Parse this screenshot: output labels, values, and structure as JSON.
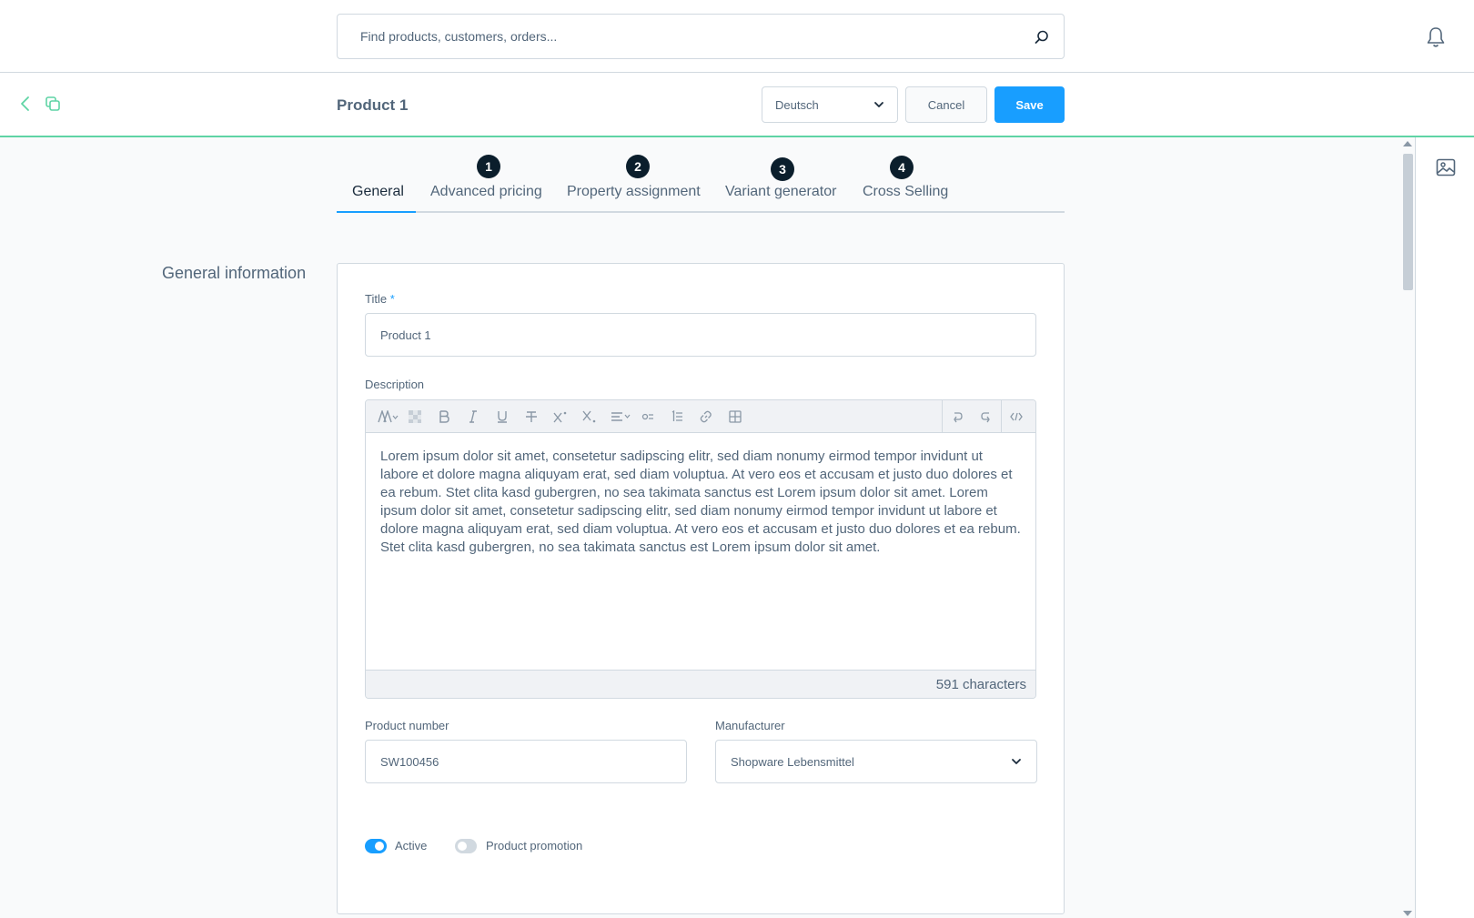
{
  "header": {
    "search_placeholder": "Find products, customers, orders...",
    "search_icon": "search-icon",
    "notification_icon": "bell-icon"
  },
  "smartbar": {
    "title": "Product 1",
    "language": "Deutsch",
    "cancel_label": "Cancel",
    "save_label": "Save",
    "back_icon": "chevron-left-icon",
    "duplicate_icon": "duplicate-icon"
  },
  "tabs": [
    {
      "label": "General",
      "badge": "",
      "active": true
    },
    {
      "label": "Advanced pricing",
      "badge": "1"
    },
    {
      "label": "Property assignment",
      "badge": "2"
    },
    {
      "label": "Variant generator",
      "badge": "3"
    },
    {
      "label": "Cross Selling",
      "badge": "4"
    }
  ],
  "section": {
    "title": "General information",
    "title_label": "Title",
    "required_mark": "*",
    "title_value": "Product 1",
    "description_label": "Description",
    "description_text": "Lorem ipsum dolor sit amet, consetetur sadipscing elitr, sed diam nonumy eirmod tempor invidunt ut labore et dolore magna aliquyam erat, sed diam voluptua. At vero eos et accusam et justo duo dolores et ea rebum. Stet clita kasd gubergren, no sea takimata sanctus est Lorem ipsum dolor sit amet. Lorem ipsum dolor sit amet, consetetur sadipscing elitr, sed diam nonumy eirmod tempor invidunt ut labore et dolore magna aliquyam erat, sed diam voluptua. At vero eos et accusam et justo duo dolores et ea rebum. Stet clita kasd gubergren, no sea takimata sanctus est Lorem ipsum dolor sit amet.",
    "char_count": "591 characters",
    "product_number_label": "Product number",
    "product_number_value": "SW100456",
    "manufacturer_label": "Manufacturer",
    "manufacturer_value": "Shopware Lebensmittel",
    "active_label": "Active",
    "active_on": true,
    "promotion_label": "Product promotion",
    "promotion_on": false
  },
  "colors": {
    "accent": "#189eff",
    "divider_accent": "#5fd4a5",
    "badge": "#0b1e2c",
    "text": "#52667a"
  }
}
